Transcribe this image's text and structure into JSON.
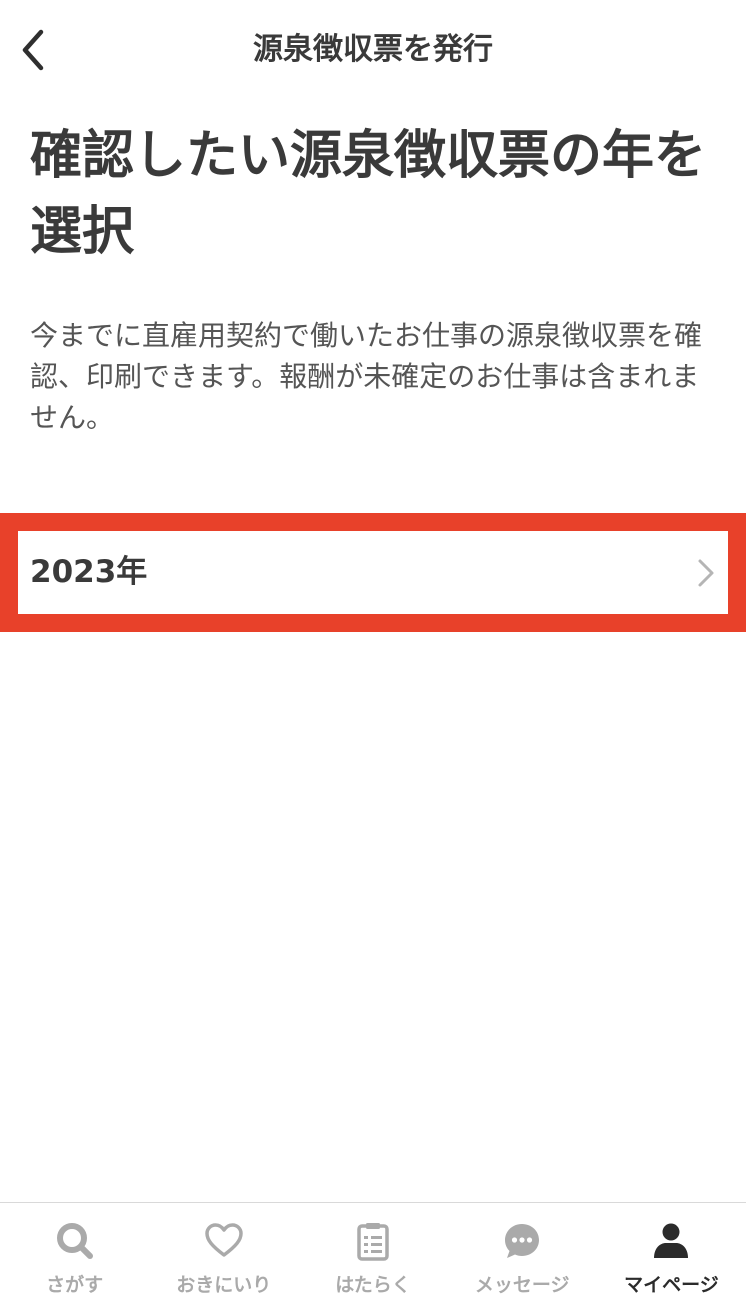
{
  "header": {
    "title": "源泉徴収票を発行",
    "back_icon": "chevron-left-icon"
  },
  "main": {
    "heading": "確認したい源泉徴収票の年を選択",
    "description": "今までに直雇用契約で働いたお仕事の源泉徴収票を確認、印刷できます。報酬が未確定のお仕事は含まれません。",
    "years": [
      {
        "label": "2023年",
        "icon": "chevron-right-icon"
      }
    ],
    "highlight_color": "#e8412a"
  },
  "tabbar": {
    "items": [
      {
        "label": "さがす",
        "icon": "search-icon",
        "active": false
      },
      {
        "label": "おきにいり",
        "icon": "heart-icon",
        "active": false
      },
      {
        "label": "はたらく",
        "icon": "clipboard-icon",
        "active": false
      },
      {
        "label": "メッセージ",
        "icon": "chat-bubble-icon",
        "active": false
      },
      {
        "label": "マイページ",
        "icon": "person-icon",
        "active": true
      }
    ],
    "inactive_color": "#aaaaaa",
    "active_color": "#2b2b2b"
  }
}
